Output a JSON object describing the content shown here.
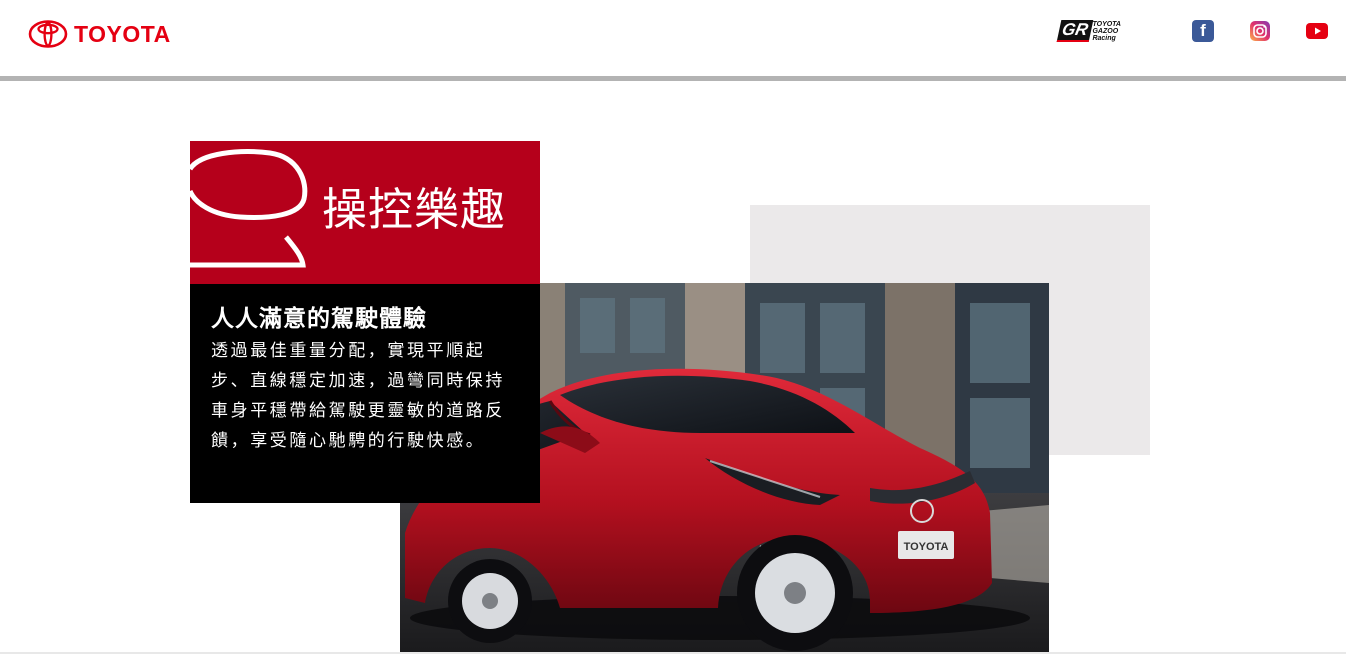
{
  "header": {
    "brand_name": "TOYOTA",
    "gr_mark": "GR",
    "gr_line1": "TOYOTA",
    "gr_line2": "GAZOO",
    "gr_line3": "Racing",
    "social": [
      "facebook-icon",
      "instagram-icon",
      "youtube-icon"
    ],
    "facebook_glyph": "f"
  },
  "feature": {
    "title": "操控樂趣",
    "heading": "人人滿意的駕駛體驗",
    "body": "透過最佳重量分配，實現平順起步、直線穩定加速，過彎同時保持車身平穩帶給駕駛更靈敏的道路反饋，享受隨心馳騁的行駛快感。",
    "photo_plate": "TOYOTA"
  },
  "colors": {
    "brand_red": "#e50012",
    "panel_red": "#b5001b",
    "panel_black": "#000000",
    "gray_panel": "#ebe9ea",
    "header_rule": "#b3b3b3",
    "facebook_blue": "#3b5998"
  }
}
